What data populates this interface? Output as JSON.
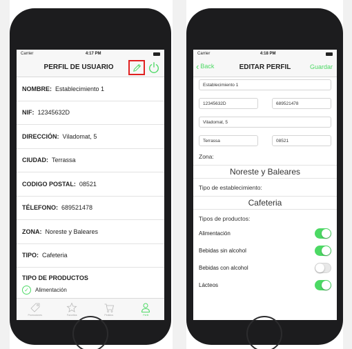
{
  "left_phone": {
    "status": {
      "carrier": "Carrier",
      "time": "4:17 PM"
    },
    "title": "PERFIL DE USUARIO",
    "fields": [
      {
        "label": "NOMBRE:",
        "value": "Establecimiento 1"
      },
      {
        "label": "NIF:",
        "value": "12345632D"
      },
      {
        "label": "DIRECCIÓN:",
        "value": "Viladomat, 5"
      },
      {
        "label": "CIUDAD:",
        "value": "Terrassa"
      },
      {
        "label": "CODIGO POSTAL:",
        "value": "08521"
      },
      {
        "label": "TÉLEFONO:",
        "value": "689521478"
      },
      {
        "label": "ZONA:",
        "value": "Noreste y Baleares"
      },
      {
        "label": "TIPO:",
        "value": "Cafeteria"
      }
    ],
    "products_header": "TIPO DE PRODUCTOS",
    "products": [
      "Alimentación"
    ],
    "tabs": [
      "Promociones",
      "Favoritos",
      "Pedidos",
      "Perfil"
    ],
    "active_tab": "Perfil",
    "accent": "#4cd964",
    "highlight": "#e02020"
  },
  "right_phone": {
    "status": {
      "carrier": "Carrier",
      "time": "4:18 PM"
    },
    "back_label": "Back",
    "title": "EDITAR PERFIL",
    "save_label": "Guardar",
    "inputs": {
      "name": "Establecimiento 1",
      "nif": "12345632D",
      "phone": "689521478",
      "address": "Viladomat, 5",
      "city": "Terrassa",
      "postal": "08521"
    },
    "zona_label": "Zona:",
    "zona_value": "Noreste y Baleares",
    "tipo_label": "Tipo de establecimiento:",
    "tipo_value": "Cafeteria",
    "products_label": "Tipos de productos:",
    "product_toggles": [
      {
        "label": "Alimentación",
        "on": true
      },
      {
        "label": "Bebidas sin alcohol",
        "on": true
      },
      {
        "label": "Bebidas con alcohol",
        "on": false
      },
      {
        "label": "Lácteos",
        "on": true
      }
    ]
  }
}
